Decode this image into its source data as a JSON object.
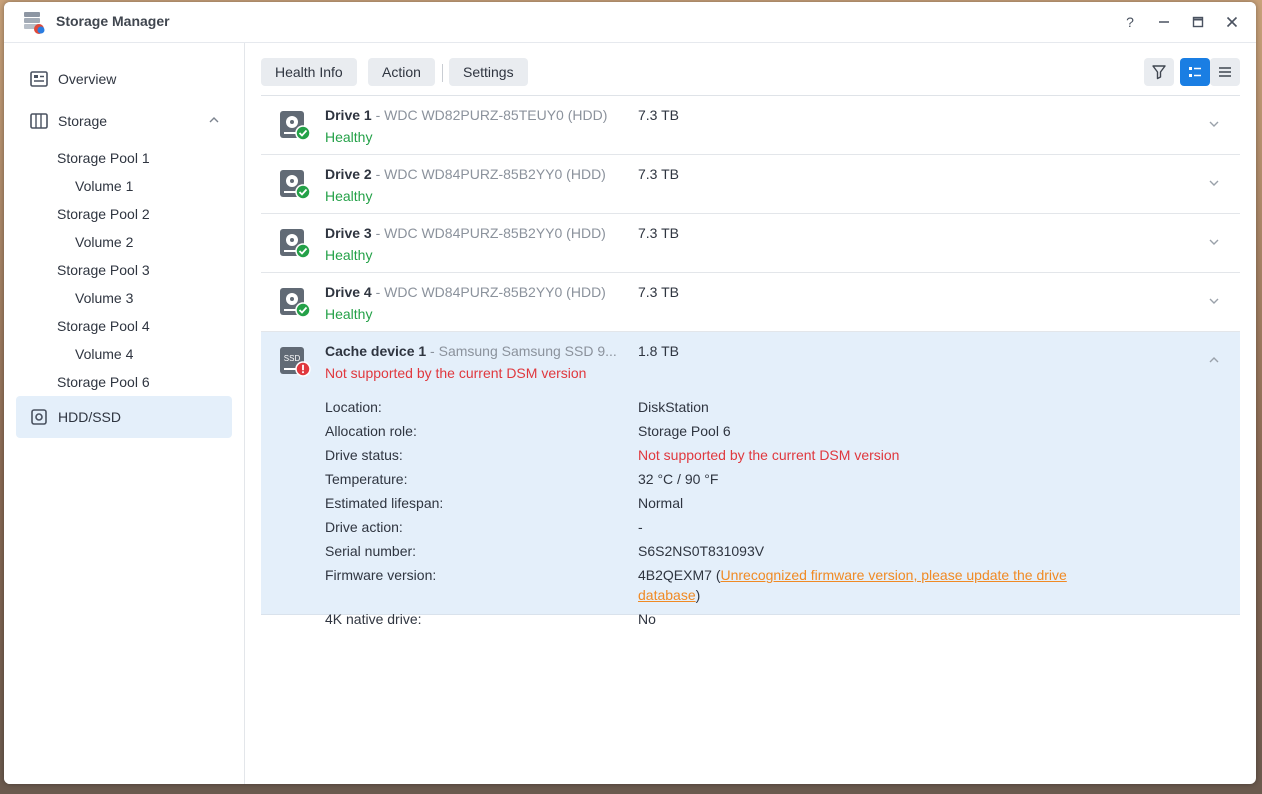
{
  "window": {
    "title": "Storage Manager"
  },
  "title_controls": {
    "help": "?",
    "minimize": "—",
    "maximize": "▭",
    "close": "✕"
  },
  "sidebar": {
    "overview": "Overview",
    "storage": "Storage",
    "pools": [
      {
        "label": "Storage Pool 1",
        "volume": "Volume 1"
      },
      {
        "label": "Storage Pool 2",
        "volume": "Volume 2"
      },
      {
        "label": "Storage Pool 3",
        "volume": "Volume 3"
      },
      {
        "label": "Storage Pool 4",
        "volume": "Volume 4"
      }
    ],
    "pool6": "Storage Pool 6",
    "hdd_ssd": "HDD/SSD"
  },
  "toolbar": {
    "health_info": "Health Info",
    "action": "Action",
    "settings": "Settings"
  },
  "drives": [
    {
      "name": "Drive 1",
      "model": " - WDC WD82PURZ-85TEUY0 (HDD)",
      "size": "7.3 TB",
      "status": "Healthy"
    },
    {
      "name": "Drive 2",
      "model": " - WDC WD84PURZ-85B2YY0 (HDD)",
      "size": "7.3 TB",
      "status": "Healthy"
    },
    {
      "name": "Drive 3",
      "model": " - WDC WD84PURZ-85B2YY0 (HDD)",
      "size": "7.3 TB",
      "status": "Healthy"
    },
    {
      "name": "Drive 4",
      "model": " - WDC WD84PURZ-85B2YY0 (HDD)",
      "size": "7.3 TB",
      "status": "Healthy"
    }
  ],
  "cache": {
    "name": "Cache device 1",
    "model": " - Samsung Samsung SSD 9...",
    "size": "1.8 TB",
    "status": "Not supported by the current DSM version",
    "icon_text": "SSD",
    "details": {
      "location_label": "Location:",
      "location": "DiskStation",
      "role_label": "Allocation role:",
      "role": "Storage Pool 6",
      "status_label": "Drive status:",
      "status": "Not supported by the current DSM version",
      "temp_label": "Temperature:",
      "temp": "32 °C / 90 °F",
      "lifespan_label": "Estimated lifespan:",
      "lifespan": "Normal",
      "action_label": "Drive action:",
      "action": "-",
      "serial_label": "Serial number:",
      "serial": "S6S2NS0T831093V",
      "fw_label": "Firmware version:",
      "fw": "4B2QEXM7",
      "fw_open": " (",
      "fw_link": "Unrecognized firmware version, please update the drive database",
      "fw_close": ")",
      "native_label": "4K native drive:",
      "native": "No"
    }
  },
  "colors": {
    "healthy": "#24a148",
    "error": "#e0383e",
    "link": "#f08a24",
    "accent": "#1a7ee3"
  }
}
